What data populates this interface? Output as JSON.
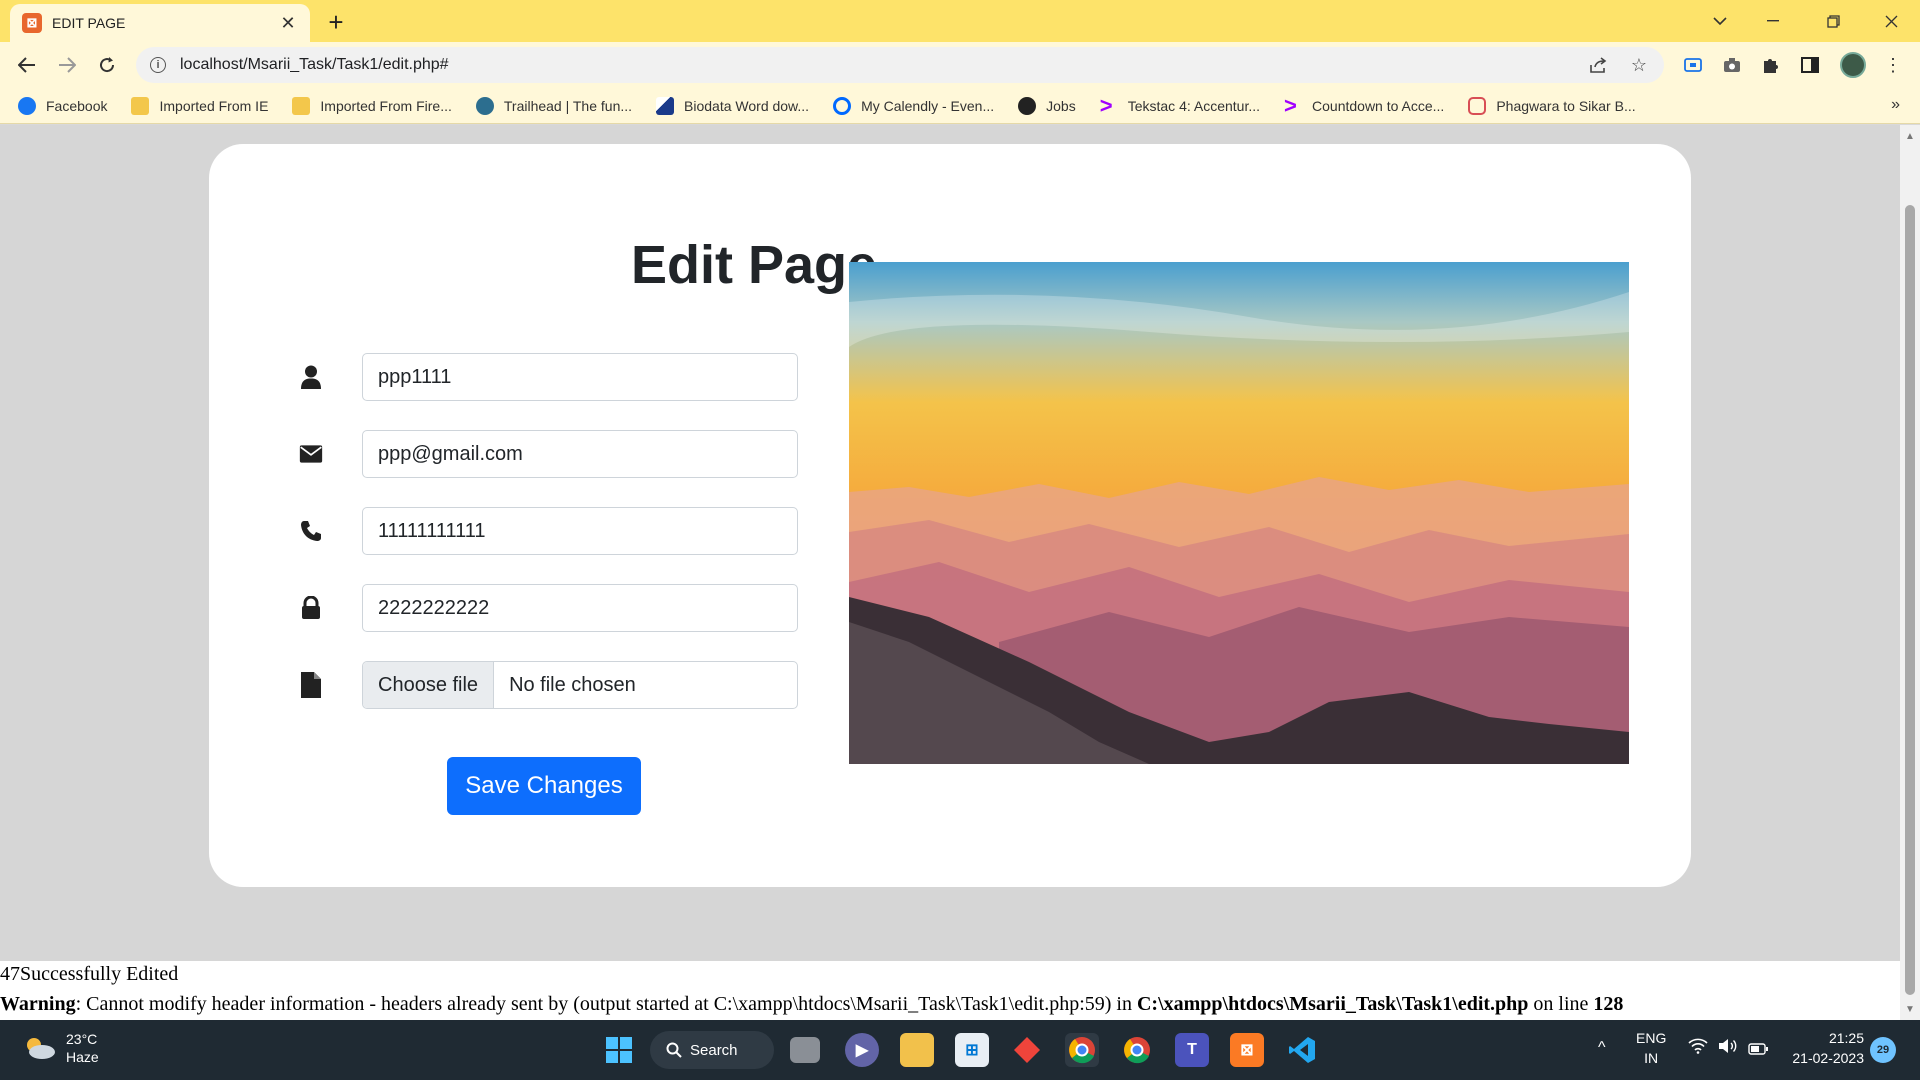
{
  "browser": {
    "tab_title": "EDIT PAGE",
    "new_tab": "+",
    "url": "localhost/Msarii_Task/Task1/edit.php#"
  },
  "bookmarks": [
    {
      "label": "Facebook",
      "icon": "facebook-icon",
      "color": "#1877f2"
    },
    {
      "label": "Imported From IE",
      "icon": "folder-icon",
      "color": "#f3c74b"
    },
    {
      "label": "Imported From Fire...",
      "icon": "folder-icon",
      "color": "#f3c74b"
    },
    {
      "label": "Trailhead | The fun...",
      "icon": "trailhead-icon",
      "color": "#2c6e8f"
    },
    {
      "label": "Biodata Word dow...",
      "icon": "feather-icon",
      "color": "#1a3a8a"
    },
    {
      "label": "My Calendly - Even...",
      "icon": "calendly-icon",
      "color": "#0069ff"
    },
    {
      "label": "Jobs",
      "icon": "globe-icon",
      "color": "#222222"
    },
    {
      "label": "Tekstac 4: Accentur...",
      "icon": "accenture-icon",
      "color": "#a100ff"
    },
    {
      "label": "Countdown to Acce...",
      "icon": "accenture-icon",
      "color": "#a100ff"
    },
    {
      "label": "Phagwara to Sikar B...",
      "icon": "bus-icon",
      "color": "#d84e55"
    }
  ],
  "page": {
    "heading": "Edit Page",
    "username_value": "ppp1111",
    "email_value": "ppp@gmail.com",
    "phone_value": "11111111111",
    "password_value": "2222222222",
    "file_button": "Choose file",
    "file_status": "No file chosen",
    "save_label": "Save Changes",
    "accent_color": "#0d6efd"
  },
  "output": {
    "success": "47Successfully Edited",
    "warning_label": "Warning",
    "warning_text": ": Cannot modify header information - headers already sent by (output started at C:\\xampp\\htdocs\\Msarii_Task\\Task1\\edit.php:59) in ",
    "warning_file": "C:\\xampp\\htdocs\\Msarii_Task\\Task1\\edit.php",
    "warning_on_line": " on line ",
    "warning_line": "128"
  },
  "taskbar": {
    "temperature": "23°C",
    "condition": "Haze",
    "search_label": "Search",
    "language": "ENG",
    "region": "IN",
    "time": "21:25",
    "date": "21-02-2023",
    "notifications": "29"
  }
}
